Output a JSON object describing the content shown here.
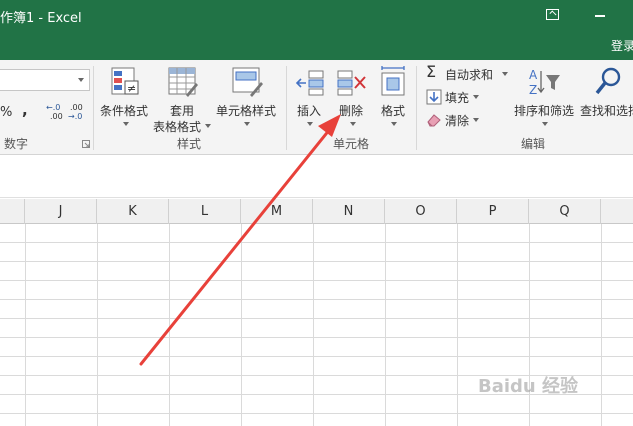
{
  "window": {
    "title": "作簿1 - Excel",
    "signin": "登录"
  },
  "ribbon": {
    "number_group": {
      "label": "数字",
      "percent": "%",
      "comma": ",",
      "increase_decimal_top": "←.0",
      "increase_decimal_bottom": ".00",
      "decrease_decimal_top": ".00",
      "decrease_decimal_bottom": "→.0"
    },
    "styles_group": {
      "label": "样式",
      "conditional_format": "条件格式",
      "format_table_line1": "套用",
      "format_table_line2": "表格格式",
      "cell_styles": "单元格样式"
    },
    "cells_group": {
      "label": "单元格",
      "insert": "插入",
      "delete": "删除",
      "format": "格式"
    },
    "editing_group": {
      "label": "编辑",
      "autosum": "自动求和",
      "fill": "填充",
      "clear": "清除",
      "sort_filter": "排序和筛选",
      "find_select": "查找和选择"
    }
  },
  "columns": [
    "J",
    "K",
    "L",
    "M",
    "N",
    "O",
    "P",
    "Q"
  ],
  "watermark": "Baidu 经验",
  "colors": {
    "title_bar": "#217346",
    "arrow": "#e8413a",
    "ribbon_bg": "#f4f4f4"
  }
}
